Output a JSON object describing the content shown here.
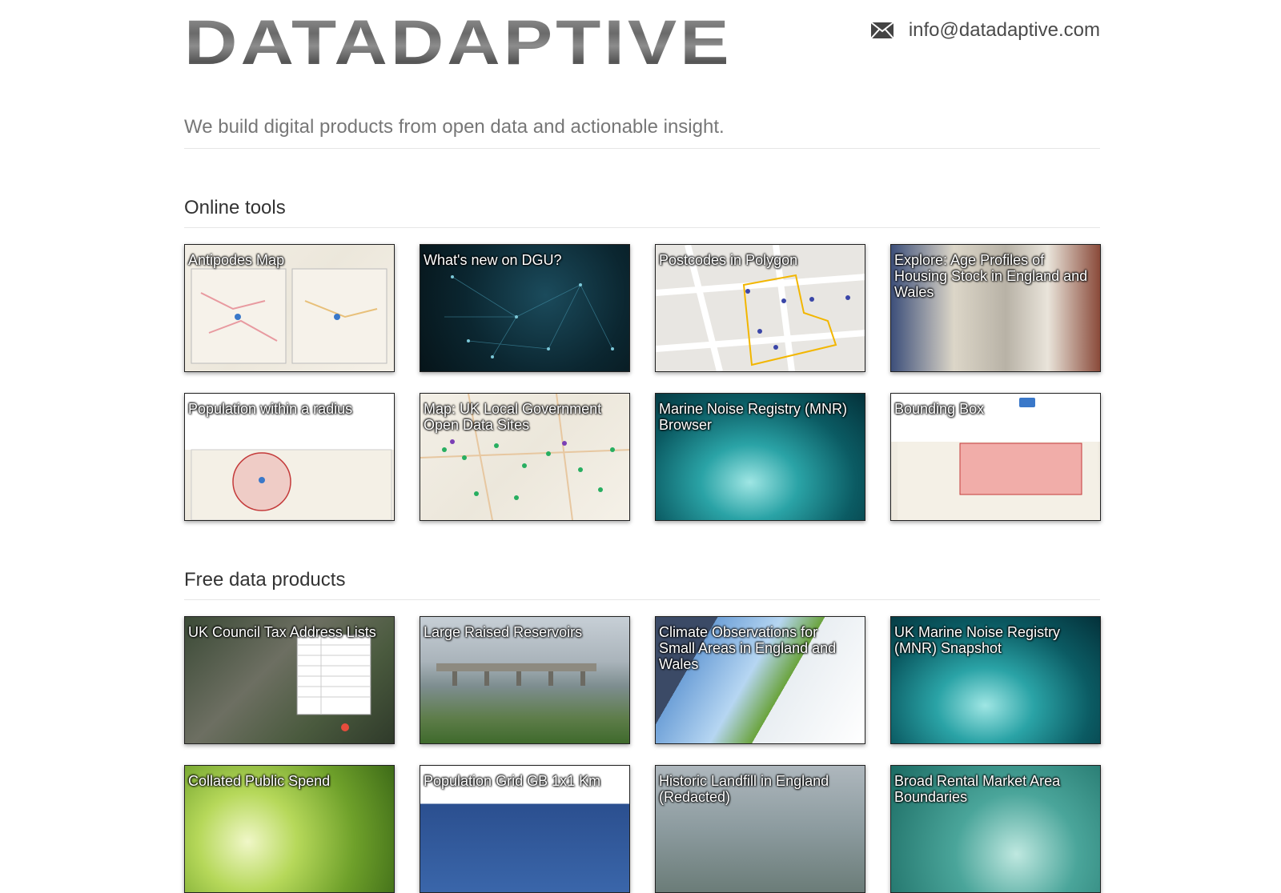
{
  "header": {
    "logo_text": "DATADAPTIVE",
    "email": "info@datadaptive.com",
    "tagline": "We build digital products from open data and actionable insight."
  },
  "sections": [
    {
      "title": "Online tools",
      "cards": [
        {
          "label": "Antipodes Map",
          "thumb": "map-screenshot"
        },
        {
          "label": "What's new on DGU?",
          "thumb": "network-graphic"
        },
        {
          "label": "Postcodes in Polygon",
          "thumb": "street-map-polygon"
        },
        {
          "label": "Explore: Age Profiles of Housing Stock in England and Wales",
          "thumb": "terraced-houses-photo"
        },
        {
          "label": "Population within a radius",
          "thumb": "radius-map"
        },
        {
          "label": "Map: UK Local Government Open Data Sites",
          "thumb": "markers-map"
        },
        {
          "label": "Marine Noise Registry (MNR) Browser",
          "thumb": "underwater-photo"
        },
        {
          "label": "Bounding Box",
          "thumb": "bbox-map"
        }
      ]
    },
    {
      "title": "Free data products",
      "cards": [
        {
          "label": "UK Council Tax Address Lists",
          "thumb": "aerial-photo"
        },
        {
          "label": "Large Raised Reservoirs",
          "thumb": "reservoir-photo"
        },
        {
          "label": "Climate Observations for Small Areas in England and Wales",
          "thumb": "weather-collage"
        },
        {
          "label": "UK Marine Noise Registry (MNR) Snapshot",
          "thumb": "underwater-photo"
        },
        {
          "label": "Collated Public Spend",
          "thumb": "seedling-photo"
        },
        {
          "label": "Population Grid GB 1x1 Km",
          "thumb": "grid-map"
        },
        {
          "label": "Historic Landfill in England (Redacted)",
          "thumb": "landfill-photo"
        },
        {
          "label": "Broad Rental Market Area Boundaries",
          "thumb": "abstract-photo"
        }
      ]
    }
  ]
}
